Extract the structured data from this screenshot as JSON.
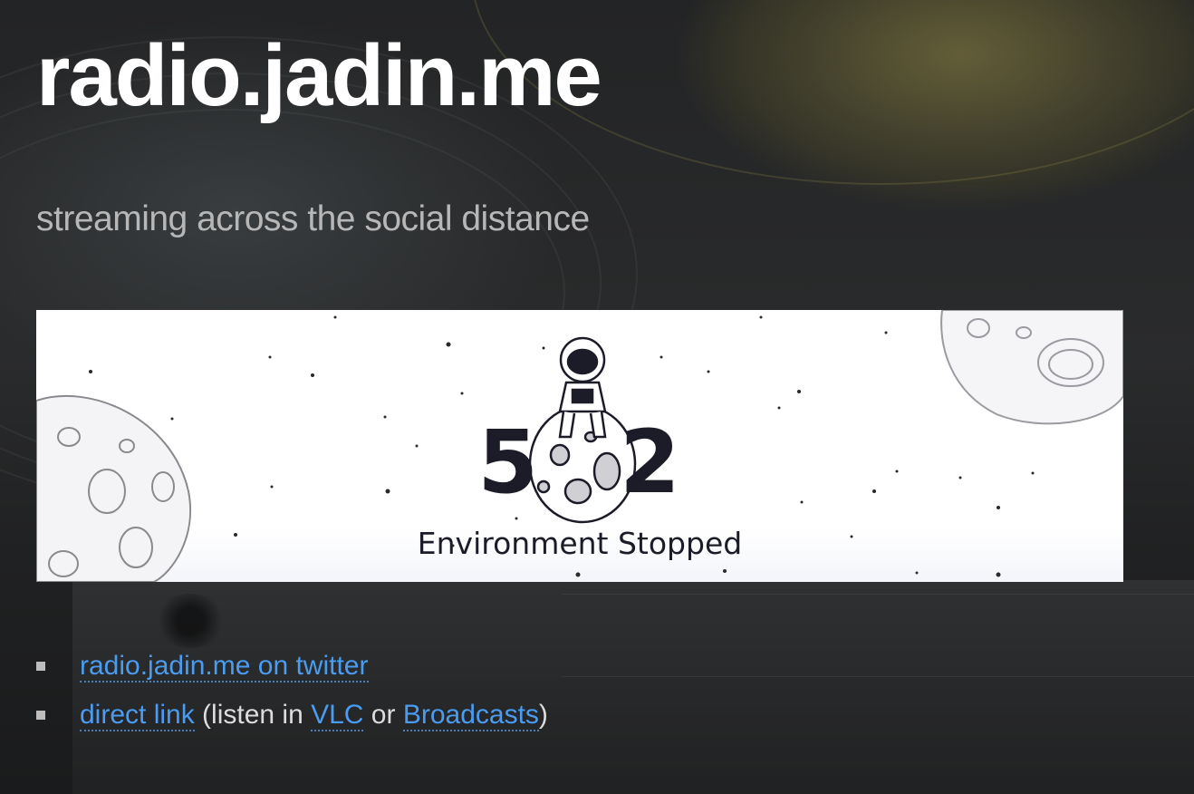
{
  "site": {
    "title": "radio.jadin.me",
    "tagline": "streaming across the social distance"
  },
  "embed": {
    "code_left": "5",
    "code_right": "2",
    "message": "Environment Stopped"
  },
  "links": {
    "twitter_label": "radio.jadin.me on twitter",
    "direct_label": "direct link",
    "listen_prefix": " (listen in ",
    "vlc_label": "VLC",
    "or_text": " or ",
    "broadcasts_label": "Broadcasts",
    "suffix": ")"
  },
  "colors": {
    "link": "#4a9cf0",
    "title": "#ffffff",
    "tagline": "#b7b7b7"
  }
}
